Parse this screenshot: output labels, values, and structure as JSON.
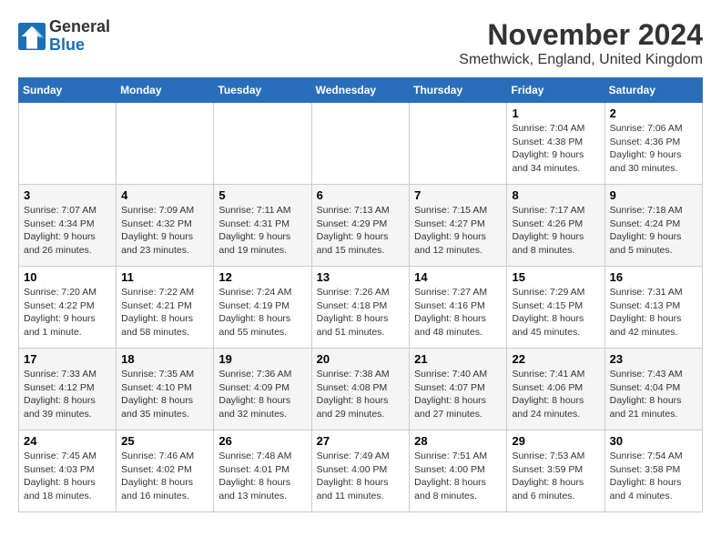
{
  "logo": {
    "general": "General",
    "blue": "Blue"
  },
  "title": "November 2024",
  "location": "Smethwick, England, United Kingdom",
  "weekdays": [
    "Sunday",
    "Monday",
    "Tuesday",
    "Wednesday",
    "Thursday",
    "Friday",
    "Saturday"
  ],
  "weeks": [
    [
      {
        "day": "",
        "info": ""
      },
      {
        "day": "",
        "info": ""
      },
      {
        "day": "",
        "info": ""
      },
      {
        "day": "",
        "info": ""
      },
      {
        "day": "",
        "info": ""
      },
      {
        "day": "1",
        "info": "Sunrise: 7:04 AM\nSunset: 4:38 PM\nDaylight: 9 hours\nand 34 minutes."
      },
      {
        "day": "2",
        "info": "Sunrise: 7:06 AM\nSunset: 4:36 PM\nDaylight: 9 hours\nand 30 minutes."
      }
    ],
    [
      {
        "day": "3",
        "info": "Sunrise: 7:07 AM\nSunset: 4:34 PM\nDaylight: 9 hours\nand 26 minutes."
      },
      {
        "day": "4",
        "info": "Sunrise: 7:09 AM\nSunset: 4:32 PM\nDaylight: 9 hours\nand 23 minutes."
      },
      {
        "day": "5",
        "info": "Sunrise: 7:11 AM\nSunset: 4:31 PM\nDaylight: 9 hours\nand 19 minutes."
      },
      {
        "day": "6",
        "info": "Sunrise: 7:13 AM\nSunset: 4:29 PM\nDaylight: 9 hours\nand 15 minutes."
      },
      {
        "day": "7",
        "info": "Sunrise: 7:15 AM\nSunset: 4:27 PM\nDaylight: 9 hours\nand 12 minutes."
      },
      {
        "day": "8",
        "info": "Sunrise: 7:17 AM\nSunset: 4:26 PM\nDaylight: 9 hours\nand 8 minutes."
      },
      {
        "day": "9",
        "info": "Sunrise: 7:18 AM\nSunset: 4:24 PM\nDaylight: 9 hours\nand 5 minutes."
      }
    ],
    [
      {
        "day": "10",
        "info": "Sunrise: 7:20 AM\nSunset: 4:22 PM\nDaylight: 9 hours\nand 1 minute."
      },
      {
        "day": "11",
        "info": "Sunrise: 7:22 AM\nSunset: 4:21 PM\nDaylight: 8 hours\nand 58 minutes."
      },
      {
        "day": "12",
        "info": "Sunrise: 7:24 AM\nSunset: 4:19 PM\nDaylight: 8 hours\nand 55 minutes."
      },
      {
        "day": "13",
        "info": "Sunrise: 7:26 AM\nSunset: 4:18 PM\nDaylight: 8 hours\nand 51 minutes."
      },
      {
        "day": "14",
        "info": "Sunrise: 7:27 AM\nSunset: 4:16 PM\nDaylight: 8 hours\nand 48 minutes."
      },
      {
        "day": "15",
        "info": "Sunrise: 7:29 AM\nSunset: 4:15 PM\nDaylight: 8 hours\nand 45 minutes."
      },
      {
        "day": "16",
        "info": "Sunrise: 7:31 AM\nSunset: 4:13 PM\nDaylight: 8 hours\nand 42 minutes."
      }
    ],
    [
      {
        "day": "17",
        "info": "Sunrise: 7:33 AM\nSunset: 4:12 PM\nDaylight: 8 hours\nand 39 minutes."
      },
      {
        "day": "18",
        "info": "Sunrise: 7:35 AM\nSunset: 4:10 PM\nDaylight: 8 hours\nand 35 minutes."
      },
      {
        "day": "19",
        "info": "Sunrise: 7:36 AM\nSunset: 4:09 PM\nDaylight: 8 hours\nand 32 minutes."
      },
      {
        "day": "20",
        "info": "Sunrise: 7:38 AM\nSunset: 4:08 PM\nDaylight: 8 hours\nand 29 minutes."
      },
      {
        "day": "21",
        "info": "Sunrise: 7:40 AM\nSunset: 4:07 PM\nDaylight: 8 hours\nand 27 minutes."
      },
      {
        "day": "22",
        "info": "Sunrise: 7:41 AM\nSunset: 4:06 PM\nDaylight: 8 hours\nand 24 minutes."
      },
      {
        "day": "23",
        "info": "Sunrise: 7:43 AM\nSunset: 4:04 PM\nDaylight: 8 hours\nand 21 minutes."
      }
    ],
    [
      {
        "day": "24",
        "info": "Sunrise: 7:45 AM\nSunset: 4:03 PM\nDaylight: 8 hours\nand 18 minutes."
      },
      {
        "day": "25",
        "info": "Sunrise: 7:46 AM\nSunset: 4:02 PM\nDaylight: 8 hours\nand 16 minutes."
      },
      {
        "day": "26",
        "info": "Sunrise: 7:48 AM\nSunset: 4:01 PM\nDaylight: 8 hours\nand 13 minutes."
      },
      {
        "day": "27",
        "info": "Sunrise: 7:49 AM\nSunset: 4:00 PM\nDaylight: 8 hours\nand 11 minutes."
      },
      {
        "day": "28",
        "info": "Sunrise: 7:51 AM\nSunset: 4:00 PM\nDaylight: 8 hours\nand 8 minutes."
      },
      {
        "day": "29",
        "info": "Sunrise: 7:53 AM\nSunset: 3:59 PM\nDaylight: 8 hours\nand 6 minutes."
      },
      {
        "day": "30",
        "info": "Sunrise: 7:54 AM\nSunset: 3:58 PM\nDaylight: 8 hours\nand 4 minutes."
      }
    ]
  ]
}
